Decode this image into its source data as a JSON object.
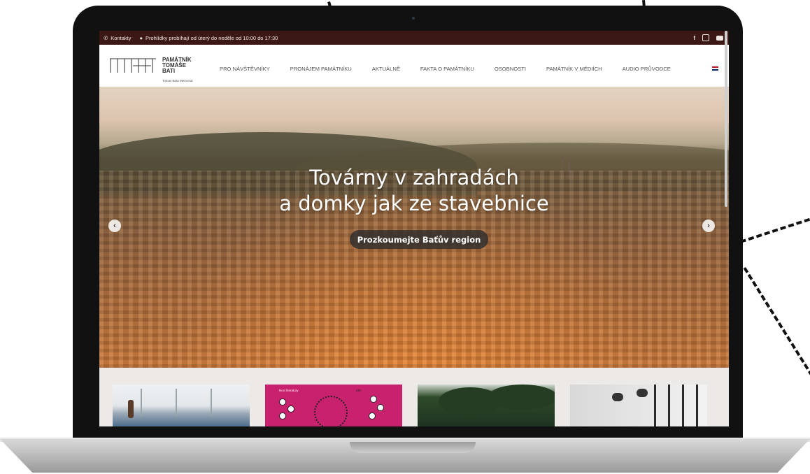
{
  "topbar": {
    "contacts_label": "Kontakty",
    "hours_text": "Prohlídky probíhají od úterý do neděle od 10:00 do 17:30",
    "social": [
      "f",
      "instagram-icon",
      "youtube-icon"
    ]
  },
  "logo": {
    "line1": "PAMÁTNÍK",
    "line2": "TOMÁŠE",
    "line3": "BATI",
    "sub": "Tomas Bata Memorial"
  },
  "nav": {
    "items": [
      "PRO NÁVŠTĚVNÍKY",
      "PRONÁJEM PAMÁTNÍKU",
      "AKTUÁLNĚ",
      "FAKTA O PAMÁTNÍKU",
      "OSOBNOSTI",
      "PAMÁTNÍK V MÉDIÍCH",
      "AUDIO PRŮVODCE"
    ]
  },
  "hero": {
    "title_line1": "Továrny v zahradách",
    "title_line2": "a domky jak ze stavebnice",
    "cta": "Prozkoumejte Baťův region"
  },
  "thumbnails": {
    "t2_label_left": "Noci literatury",
    "t2_label_right": "Zlín"
  },
  "colors": {
    "topbar_bg": "#3b1814",
    "cta_bg": "#2d2d2d",
    "thumb_magenta": "#c8226e"
  }
}
